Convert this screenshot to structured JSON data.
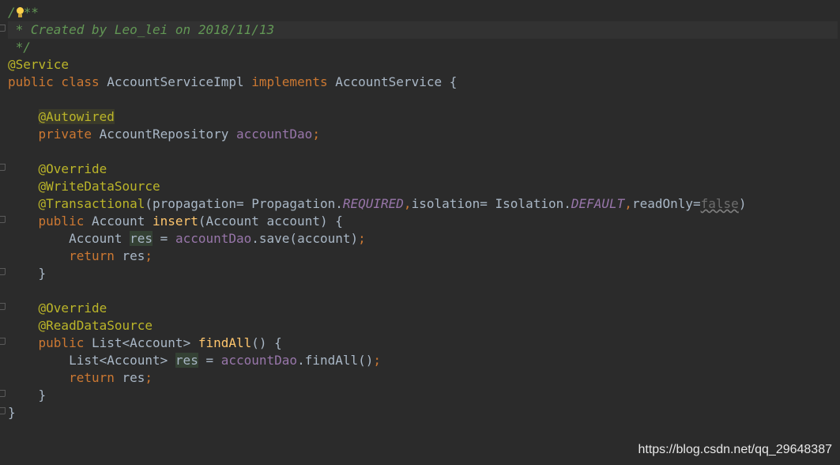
{
  "lines": [
    [
      "/",
      "**"
    ],
    [
      " * Created by Leo_lei on 2018/11/13"
    ],
    [
      " */"
    ],
    [
      "@Service"
    ],
    [
      "public class ",
      "AccountServiceImpl ",
      "implements ",
      "AccountService {"
    ],
    [
      ""
    ],
    [
      "    ",
      "@Autowired"
    ],
    [
      "    ",
      "private ",
      "AccountRepository ",
      "accountDao",
      ";"
    ],
    [
      ""
    ],
    [
      "    ",
      "@Override"
    ],
    [
      "    ",
      "@WriteDataSource"
    ],
    [
      "    ",
      "@Transactional",
      "(",
      "propagation",
      "= Propagation.",
      "REQUIRED",
      ",",
      "isolation",
      "= Isolation.",
      "DEFAULT",
      ",",
      "readOnly",
      "=",
      "false",
      ")"
    ],
    [
      "    ",
      "public ",
      "Account ",
      "insert",
      "(Account account) {"
    ],
    [
      "        ",
      "Account ",
      "res",
      " = ",
      "accountDao",
      ".save(account)",
      ";"
    ],
    [
      "        ",
      "return ",
      "res",
      ";"
    ],
    [
      "    }"
    ],
    [
      ""
    ],
    [
      "    ",
      "@Override"
    ],
    [
      "    ",
      "@ReadDataSource"
    ],
    [
      "    ",
      "public ",
      "List<Account> ",
      "findAll",
      "() {"
    ],
    [
      "        ",
      "List<Account> ",
      "res",
      " = ",
      "accountDao",
      ".findAll()",
      ";"
    ],
    [
      "        ",
      "return ",
      "res",
      ";"
    ],
    [
      "    }"
    ],
    [
      "}"
    ]
  ],
  "watermark": "https://blog.csdn.net/qq_29648387",
  "colors": {
    "background": "#2b2b2b",
    "keyword": "#cc7832",
    "annotation": "#bbb529",
    "field": "#9876aa",
    "method": "#ffc66d",
    "comment": "#629755",
    "text": "#a9b7c6"
  },
  "icons": [
    "intention-bulb-icon",
    "fold-marker-icon"
  ]
}
